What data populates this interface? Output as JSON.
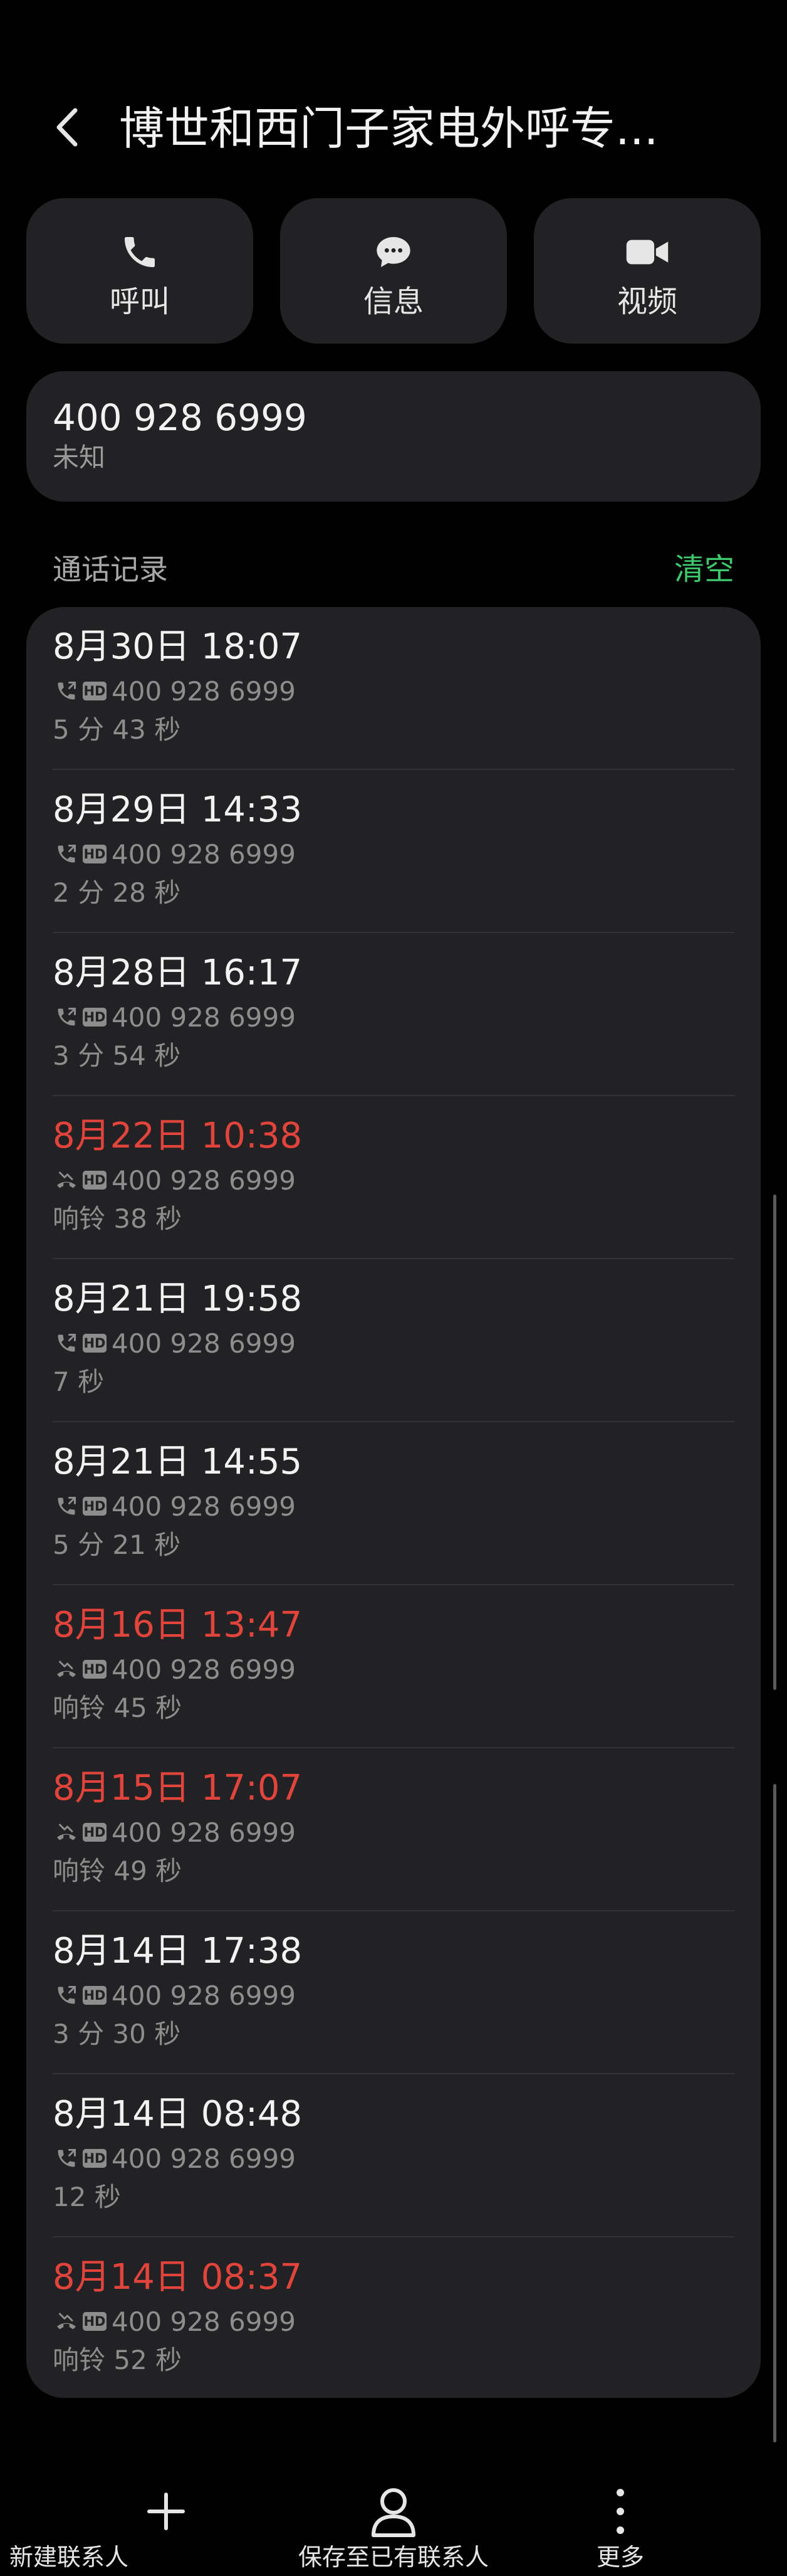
{
  "header": {
    "back_icon": "back-arrow-icon",
    "title": "博世和西门子家电外呼专..."
  },
  "actions": [
    {
      "label": "呼叫",
      "icon": "phone-icon"
    },
    {
      "label": "信息",
      "icon": "message-icon"
    },
    {
      "label": "视频",
      "icon": "video-icon"
    }
  ],
  "number_card": {
    "number": "400 928 6999",
    "type": "未知"
  },
  "call_log": {
    "title": "通话记录",
    "clear_label": "清空",
    "items": [
      {
        "datetime": "8月30日 18:07",
        "number": "400 928 6999",
        "duration": "5 分 43 秒",
        "missed": false,
        "icon": "outgoing-call-icon",
        "hd": "HD"
      },
      {
        "datetime": "8月29日 14:33",
        "number": "400 928 6999",
        "duration": "2 分 28 秒",
        "missed": false,
        "icon": "outgoing-call-icon",
        "hd": "HD"
      },
      {
        "datetime": "8月28日 16:17",
        "number": "400 928 6999",
        "duration": "3 分 54 秒",
        "missed": false,
        "icon": "outgoing-call-icon",
        "hd": "HD"
      },
      {
        "datetime": "8月22日 10:38",
        "number": "400 928 6999",
        "duration": "响铃 38 秒",
        "missed": true,
        "icon": "missed-call-icon",
        "hd": "HD"
      },
      {
        "datetime": "8月21日 19:58",
        "number": "400 928 6999",
        "duration": "7 秒",
        "missed": false,
        "icon": "outgoing-call-icon",
        "hd": "HD"
      },
      {
        "datetime": "8月21日 14:55",
        "number": "400 928 6999",
        "duration": "5 分 21 秒",
        "missed": false,
        "icon": "outgoing-call-icon",
        "hd": "HD"
      },
      {
        "datetime": "8月16日 13:47",
        "number": "400 928 6999",
        "duration": "响铃 45 秒",
        "missed": true,
        "icon": "missed-call-icon",
        "hd": "HD"
      },
      {
        "datetime": "8月15日 17:07",
        "number": "400 928 6999",
        "duration": "响铃 49 秒",
        "missed": true,
        "icon": "missed-call-icon",
        "hd": "HD"
      },
      {
        "datetime": "8月14日 17:38",
        "number": "400 928 6999",
        "duration": "3 分 30 秒",
        "missed": false,
        "icon": "outgoing-call-icon",
        "hd": "HD"
      },
      {
        "datetime": "8月14日 08:48",
        "number": "400 928 6999",
        "duration": "12 秒",
        "missed": false,
        "icon": "outgoing-call-icon",
        "hd": "HD"
      },
      {
        "datetime": "8月14日 08:37",
        "number": "400 928 6999",
        "duration": "响铃 52 秒",
        "missed": true,
        "icon": "missed-call-icon",
        "hd": "HD"
      }
    ]
  },
  "bottom_bar": [
    {
      "label": "新建联系人",
      "icon": "plus-icon"
    },
    {
      "label": "保存至已有联系人",
      "icon": "person-icon"
    },
    {
      "label": "更多",
      "icon": "more-vertical-icon"
    }
  ],
  "colors": {
    "background": "#000000",
    "card": "#222224",
    "accent_green": "#3ec96c",
    "missed_red": "#e2443c",
    "secondary_text": "#8d8d8d"
  }
}
